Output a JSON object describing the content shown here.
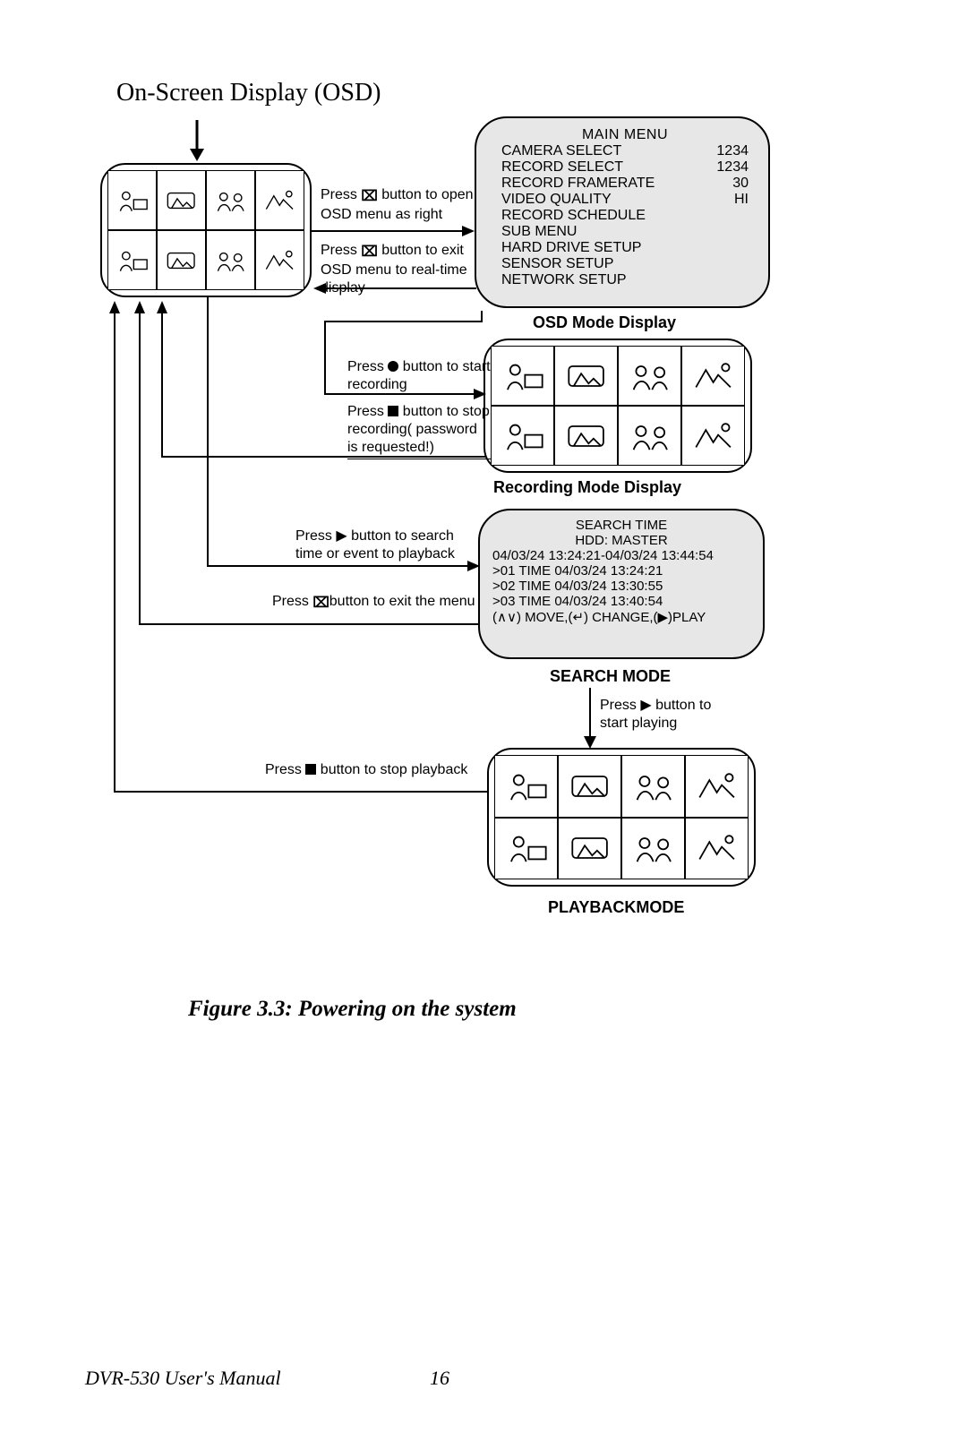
{
  "title": "On-Screen Display (OSD)",
  "caption": "Figure 3.3: Powering on the system",
  "footer": {
    "left": "DVR-530 User's Manual",
    "page": "16"
  },
  "headings": {
    "osd_mode": "OSD Mode Display",
    "recording_mode": "Recording Mode Display",
    "search_mode": "SEARCH MODE",
    "playback_mode": "PLAYBACKMODE"
  },
  "labels": {
    "press_open_osd_a": "Press ",
    "press_open_osd_b": "button to open OSD menu as right",
    "press_exit_osd_a": "Press ",
    "press_exit_osd_b": "button to exit OSD menu to real-time display",
    "press_record_a": "Press ",
    "press_record_b": " button to start recording",
    "press_stop_a": "Press ",
    "press_stop_b": " button to stop recording( password is requested!)",
    "press_search_a": "Press ",
    "press_search_b": " button to  search time or event to playback",
    "press_exit_menu_a": "Press ",
    "press_exit_menu_b": "button to  exit the menu",
    "press_play_a": "Press ",
    "press_play_b": " button to  start playing",
    "press_stop_play_a": "Press ",
    "press_stop_play_b": " button to  stop playback"
  },
  "main_menu": {
    "title": "MAIN MENU",
    "rows": [
      {
        "label": "CAMERA SELECT",
        "value": "1234"
      },
      {
        "label": "RECORD SELECT",
        "value": "1234"
      },
      {
        "label": "RECORD FRAMERATE",
        "value": "30"
      },
      {
        "label": "VIDEO QUALITY",
        "value": "HI"
      },
      {
        "label": "RECORD SCHEDULE",
        "value": ""
      },
      {
        "label": "SUB MENU",
        "value": ""
      },
      {
        "label": "HARD DRIVE SETUP",
        "value": ""
      },
      {
        "label": "SENSOR SETUP",
        "value": ""
      },
      {
        "label": "NETWORK  SETUP",
        "value": ""
      }
    ]
  },
  "search": {
    "title": "SEARCH TIME",
    "hdd": "HDD: MASTER",
    "range": "04/03/24 13:24:21-04/03/24 13:44:54",
    "lines": [
      ">01 TIME 04/03/24 13:24:21",
      ">02 TIME 04/03/24 13:30:55",
      ">03 TIME 04/03/24 13:40:54"
    ],
    "hint": "(∧∨) MOVE,(↵) CHANGE,(▶)PLAY"
  }
}
